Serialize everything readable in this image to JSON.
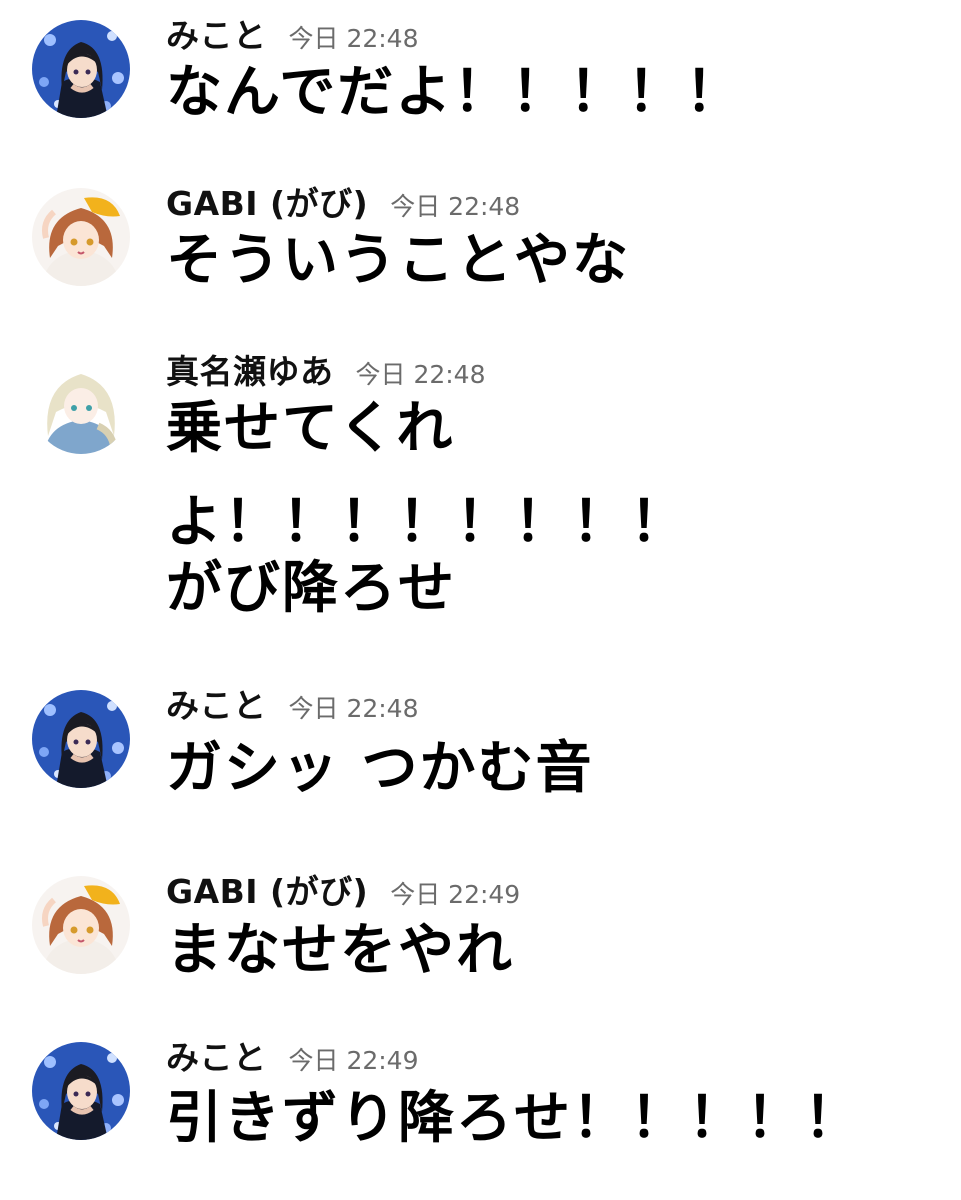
{
  "messages": [
    {
      "user": "みこと",
      "time": "今日 22:48",
      "lines": [
        "なんでだよ！！！！！"
      ],
      "avatar": "mikoto-avatar"
    },
    {
      "user": "GABI (がび)",
      "time": "今日 22:48",
      "lines": [
        "そういうことやな"
      ],
      "avatar": "gabi-avatar"
    },
    {
      "user": "真名瀬ゆあ",
      "time": "今日 22:48",
      "lines": [
        "乗せてくれ",
        "よ！！！！！！！！",
        "がび降ろせ"
      ],
      "avatar": "yua-avatar"
    },
    {
      "user": "みこと",
      "time": "今日 22:48",
      "lines": [
        "ガシッ つかむ音"
      ],
      "avatar": "mikoto-avatar"
    },
    {
      "user": "GABI (がび)",
      "time": "今日 22:49",
      "lines": [
        "まなせをやれ"
      ],
      "avatar": "gabi-avatar"
    },
    {
      "user": "みこと",
      "time": "今日 22:49",
      "lines": [
        "引きずり降ろせ！！！！！"
      ],
      "avatar": "mikoto-avatar"
    }
  ],
  "colors": {
    "background": "#ffffff",
    "text": "#000000",
    "timestamp": "#6b6b6b",
    "mikoto_avatar_bg": "#2a56b8",
    "gabi_hair": "#b9683c",
    "gabi_hat": "#f2b21c",
    "yua_hair": "#e8e2c8",
    "yua_dress": "#7fa6cc"
  }
}
